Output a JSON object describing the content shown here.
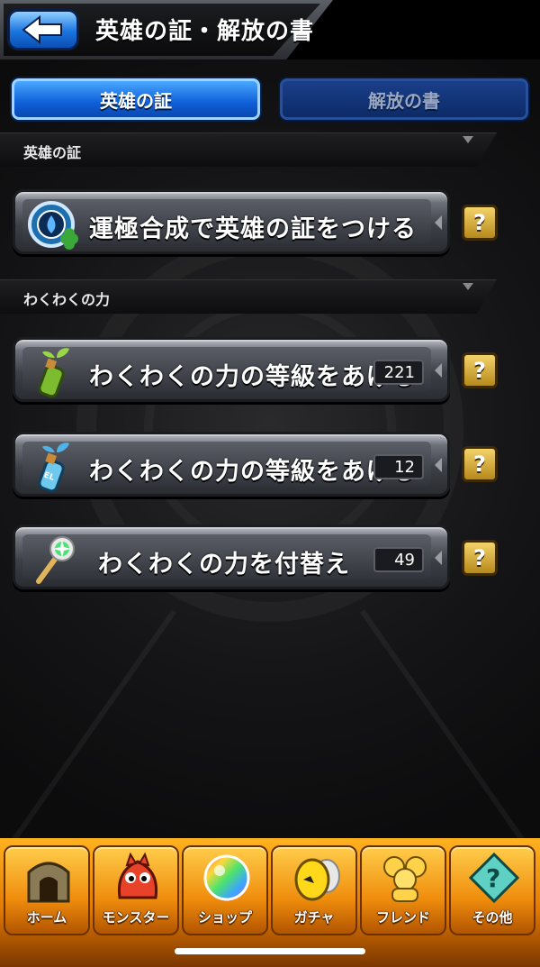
{
  "header": {
    "title": "英雄の証・解放の書",
    "back_icon": "back-arrow-icon"
  },
  "tabs": [
    {
      "label": "英雄の証",
      "active": true
    },
    {
      "label": "解放の書",
      "active": false
    }
  ],
  "sections": [
    {
      "title": "英雄の証",
      "items": [
        {
          "label": "運極合成で英雄の証をつける",
          "icon": "hero-badge-clover-icon",
          "count": null,
          "help": "?"
        }
      ]
    },
    {
      "title": "わくわくの力",
      "items": [
        {
          "label": "わくわくの力の等級をあげる",
          "icon": "green-sprout-bottle-icon",
          "count": "221",
          "help": "?"
        },
        {
          "label": "わくわくの力の等級をあげる",
          "icon": "blue-el-bottle-icon",
          "count": "12",
          "help": "?"
        },
        {
          "label": "わくわくの力を付替え",
          "icon": "magic-wand-icon",
          "count": "49",
          "help": "?"
        }
      ]
    }
  ],
  "bottom_nav": [
    {
      "label": "ホーム",
      "icon": "home-gate-icon"
    },
    {
      "label": "モンスター",
      "icon": "red-dragon-icon"
    },
    {
      "label": "ショップ",
      "icon": "rainbow-orb-icon"
    },
    {
      "label": "ガチャ",
      "icon": "yellow-egg-icon"
    },
    {
      "label": "フレンド",
      "icon": "friends-balloons-icon"
    },
    {
      "label": "その他",
      "icon": "question-diamond-icon"
    }
  ],
  "colors": {
    "tab_active": "#0f5fd8",
    "tab_inactive": "#0c2a66",
    "help_button": "#d9a83a",
    "bottom_nav": "#f08d0d"
  }
}
